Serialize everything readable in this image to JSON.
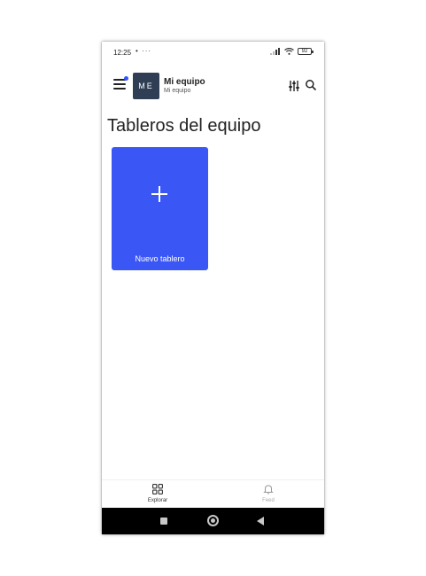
{
  "status_bar": {
    "time": "12:25",
    "extra": "• ···",
    "battery": "92"
  },
  "header": {
    "avatar_initials": "ME",
    "team_name": "Mi equipo",
    "team_subtitle": "Mi equipo",
    "icons": [
      "menu-icon",
      "filter-icon",
      "search-icon"
    ]
  },
  "main": {
    "title": "Tableros del equipo",
    "new_board_label": "Nuevo tablero"
  },
  "bottom_nav": {
    "items": [
      {
        "label": "Explorar",
        "icon": "grid-icon",
        "active": true
      },
      {
        "label": "Feed",
        "icon": "bell-icon",
        "active": false
      }
    ]
  },
  "colors": {
    "accent": "#3a57f5",
    "avatar_bg": "#2f3e55",
    "notification_dot": "#2f55ff"
  }
}
